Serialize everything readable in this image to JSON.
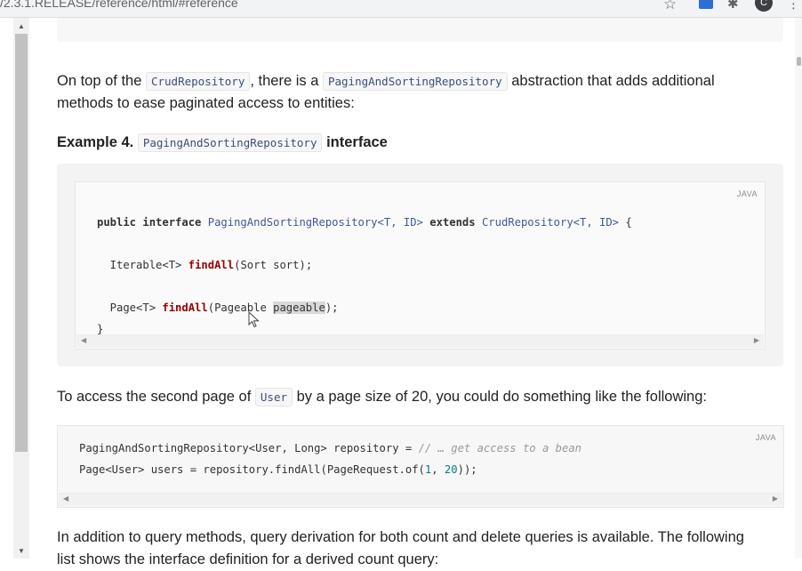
{
  "browser": {
    "url": "/2.3.1.RELEASE/reference/html/#reference",
    "avatar_letter": "C",
    "icons": [
      "star-icon",
      "extension-icon",
      "puzzle-icon",
      "kebab-menu-icon"
    ]
  },
  "paragraph1": {
    "before": "On top of the ",
    "code1": "CrudRepository",
    "mid": ", there is a ",
    "code2": "PagingAndSortingRepository",
    "after": " abstraction that adds additional methods to ease paginated access to entities:"
  },
  "example4": {
    "prefix": "Example 4. ",
    "code": "PagingAndSortingRepository",
    "suffix": " interface",
    "lang": "JAVA",
    "lines": {
      "l1_kw1": "public interface ",
      "l1_type": "PagingAndSortingRepository<T, ID>",
      "l1_kw2": " extends ",
      "l1_type2": "CrudRepository<T, ID>",
      "l1_end": " {",
      "l2_pre": "  Iterable<T> ",
      "l2_fn": "findAll",
      "l2_post": "(Sort sort);",
      "l3_pre": "  Page<T> ",
      "l3_fn": "findAll",
      "l3_mid": "(Pageable ",
      "l3_hl": "pageable",
      "l3_post": ");",
      "l4": "}"
    }
  },
  "paragraph2": {
    "before": "To access the second page of ",
    "code": "User",
    "after": " by a page size of 20, you could do something like the following:"
  },
  "code2": {
    "lang": "JAVA",
    "line1_pre": "PagingAndSortingRepository<User, Long> repository = ",
    "line1_comment": "// … get access to a bean",
    "line2_pre": "Page<User> users = repository.findAll(PageRequest.of(",
    "num1": "1",
    "comma": ", ",
    "num2": "20",
    "line2_post": "));"
  },
  "paragraph3": {
    "line1": "In addition to query methods, query derivation for both count and delete queries is available. The following",
    "line2": "list shows the interface definition for a derived count query:"
  }
}
